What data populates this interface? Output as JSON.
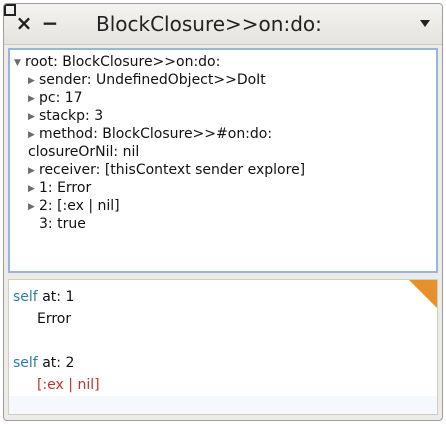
{
  "window": {
    "title": "BlockClosure>>on:do:",
    "close_glyph": "×",
    "minimize_glyph": "−",
    "menu_icon": "triangle-down-icon"
  },
  "tree": {
    "items": [
      {
        "expander": "▼",
        "label": "root: BlockClosure>>on:do:"
      },
      {
        "expander": "▶",
        "label": "sender: UndefinedObject>>DoIt"
      },
      {
        "expander": "▶",
        "label": "pc: 17"
      },
      {
        "expander": "▶",
        "label": "stackp: 3"
      },
      {
        "expander": "▶",
        "label": "method: BlockClosure>>#on:do:"
      },
      {
        "expander": "",
        "label": "closureOrNil: nil"
      },
      {
        "expander": "▶",
        "label": "receiver: [thisContext sender explore]"
      },
      {
        "expander": "▶",
        "label": "1: Error"
      },
      {
        "expander": "▶",
        "label": "2: [:ex | nil]"
      },
      {
        "expander": "",
        "label": "3: true"
      }
    ]
  },
  "code": {
    "lines": [
      {
        "keyword": "self",
        "selector": "at:",
        "arg": "1"
      },
      {
        "result": "Error"
      },
      {
        "keyword": "self",
        "selector": "at:",
        "arg": "2"
      },
      {
        "result": "[:ex | nil]"
      }
    ]
  },
  "colors": {
    "keyword": "#2f7da5",
    "error_result": "#c0332b",
    "pane_focus_border": "#98b6da",
    "corner_accent": "#e8912c"
  }
}
